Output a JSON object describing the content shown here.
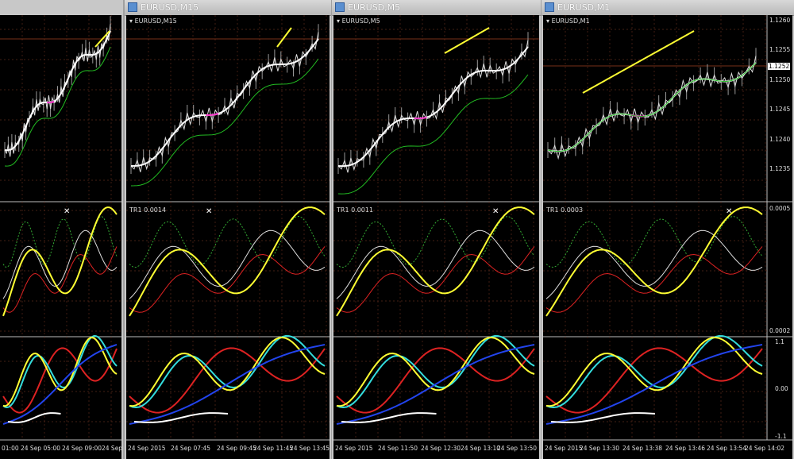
{
  "windows": [
    {
      "title": "",
      "symbol": "",
      "indicator": "",
      "time_labels": [
        "01:00",
        "24 Sep 05:00",
        "24 Sep 09:00",
        "24 Sep"
      ]
    },
    {
      "title": "EURUSD,M15",
      "symbol": "EURUSD,M15",
      "indicator": "TR1 0.0014",
      "time_labels": [
        "24 Sep 2015",
        "24 Sep 07:45",
        "24 Sep 09:45",
        "24 Sep 11:45",
        "24 Sep 13:45"
      ]
    },
    {
      "title": "EURUSD,M5",
      "symbol": "EURUSD,M5",
      "indicator": "TR1 0.0011",
      "time_labels": [
        "24 Sep 2015",
        "24 Sep 11:50",
        "24 Sep 12:30",
        "24 Sep 13:10",
        "24 Sep 13:50"
      ]
    },
    {
      "title": "EURUSD,M1",
      "symbol": "EURUSD,M1",
      "indicator": "TR1 0.0003",
      "time_labels": [
        "24 Sep 2015",
        "24 Sep 13:30",
        "24 Sep 13:38",
        "24 Sep 13:46",
        "24 Sep 13:54",
        "24 Sep 14:02"
      ],
      "price_axis": [
        "1.1260",
        "1.1255",
        "1.1250",
        "1.1245",
        "1.1240",
        "1.1235"
      ],
      "price_current": "1.1252",
      "ind_axis": [
        "0.0005",
        "0.0002"
      ],
      "osc_axis": [
        "1.1",
        "0.00",
        "-1.1"
      ]
    }
  ],
  "colors": {
    "background": "#000000",
    "grid": "#5a2a1a",
    "price_line": "#ffffff",
    "signal_line": "#ff33cc",
    "trend_line": "#ffff33",
    "support_line": "#22bb22",
    "red_line": "#dd2222",
    "cyan_line": "#33dddd",
    "blue_line": "#2244ee",
    "dotted_green": "#33aa33"
  }
}
